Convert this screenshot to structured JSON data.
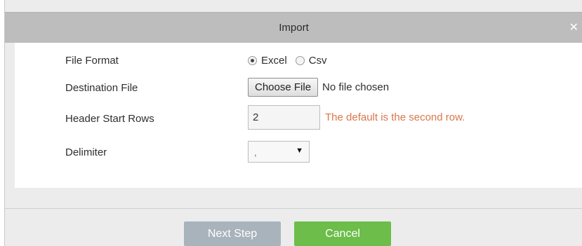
{
  "dialog": {
    "title": "Import",
    "close_icon": "close-icon"
  },
  "form": {
    "file_format": {
      "label": "File Format",
      "options": [
        "Excel",
        "Csv"
      ],
      "selected": "Excel"
    },
    "destination_file": {
      "label": "Destination File",
      "button_label": "Choose File",
      "status": "No file chosen"
    },
    "header_start_rows": {
      "label": "Header Start Rows",
      "value": "2",
      "hint": "The default is the second row."
    },
    "delimiter": {
      "label": "Delimiter",
      "value": ","
    }
  },
  "footer": {
    "next_label": "Next Step",
    "cancel_label": "Cancel"
  },
  "colors": {
    "titlebar": "#bdbdbd",
    "hint": "#d9774a",
    "next_disabled": "#a9b3bc",
    "cancel": "#6cbd4a"
  }
}
